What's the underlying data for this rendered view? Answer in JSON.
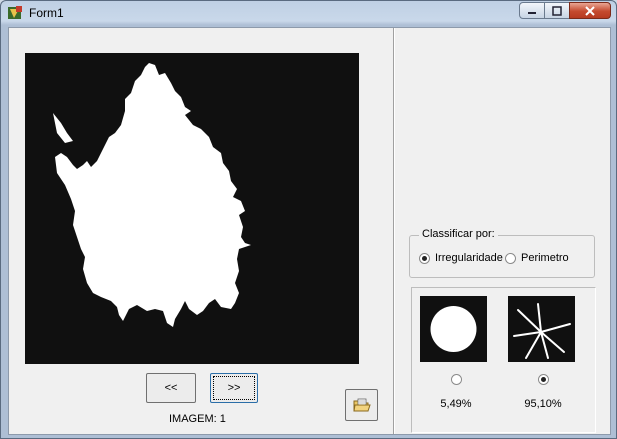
{
  "window": {
    "title": "Form1"
  },
  "navigation": {
    "prev_label": "<<",
    "next_label": ">>"
  },
  "image_label": "IMAGEM: 1",
  "classify": {
    "title": "Classificar por:",
    "options": [
      {
        "label": "Irregularidade",
        "selected": true
      },
      {
        "label": "Perimetro",
        "selected": false
      }
    ]
  },
  "references": [
    {
      "name": "circle",
      "value": "5,49%",
      "selected": false
    },
    {
      "name": "star",
      "value": "95,10%",
      "selected": true
    }
  ],
  "colors": {
    "image_bg": "#101010",
    "shape": "#ffffff",
    "title_bar": "#c9d8ea",
    "close_button": "#c54a2f"
  }
}
